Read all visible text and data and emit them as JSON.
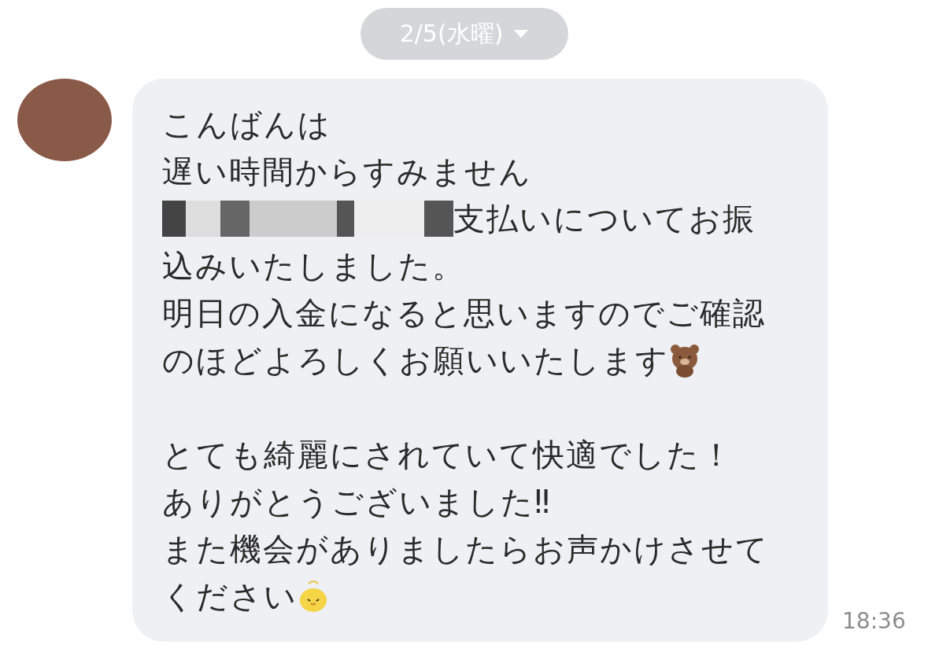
{
  "date_pill": {
    "label": "2/5(水曜)"
  },
  "message": {
    "lines": [
      {
        "kind": "text",
        "text": "こんばんは"
      },
      {
        "kind": "text",
        "text": "遅い時間からすみません"
      },
      {
        "kind": "redacted",
        "text": "支払いについてお振"
      },
      {
        "kind": "text",
        "text": "込みいたしました。"
      },
      {
        "kind": "text",
        "text": "明日の入金になると思いますのでご確認"
      },
      {
        "kind": "bear",
        "text": "のほどよろしくお願いいたします"
      },
      {
        "kind": "blank"
      },
      {
        "kind": "text",
        "text": "とても綺麗にされていて快適でした！"
      },
      {
        "kind": "text",
        "text": "ありがとうございました‼"
      },
      {
        "kind": "text",
        "text": "また機会がありましたらお声かけさせて"
      },
      {
        "kind": "chick",
        "text": "ください"
      }
    ],
    "time": "18:36"
  }
}
